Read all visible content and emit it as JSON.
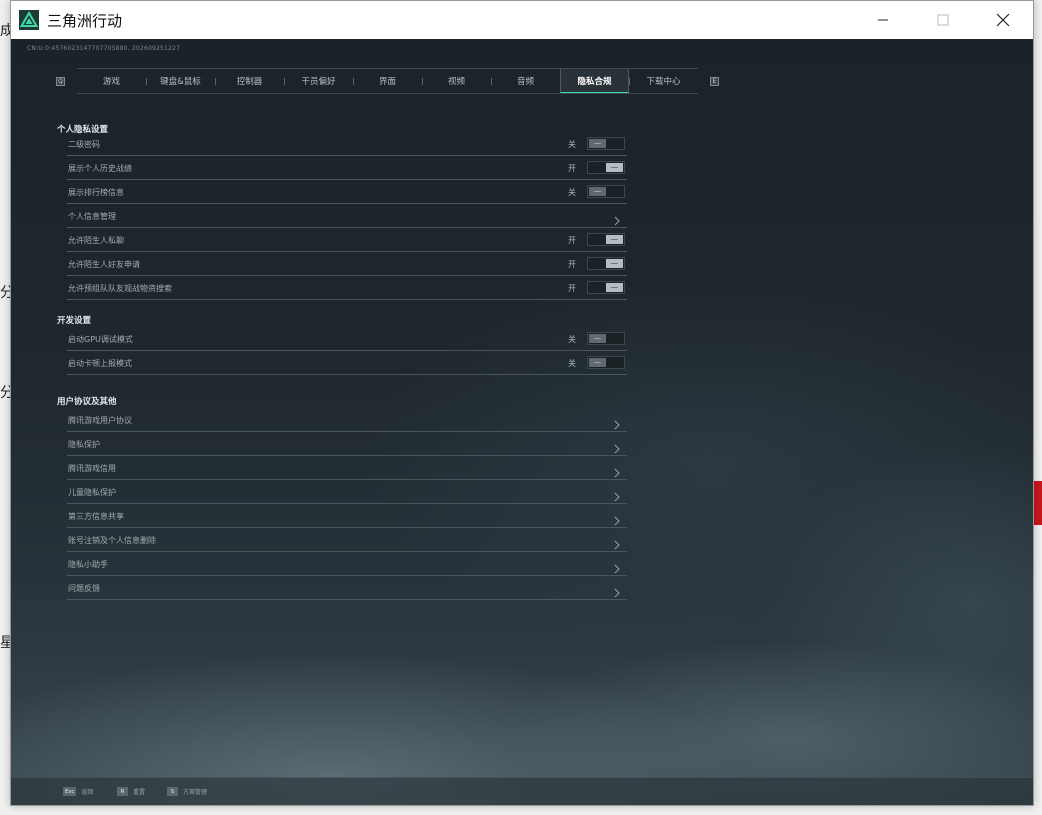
{
  "window": {
    "title": "三角洲行动"
  },
  "game": {
    "uid": "CN:U:0:4576023147707705880, 202609251227",
    "tabs": [
      {
        "label": "游戏",
        "active": false
      },
      {
        "label": "键盘&鼠标",
        "active": false
      },
      {
        "label": "控制器",
        "active": false
      },
      {
        "label": "干员偏好",
        "active": false
      },
      {
        "label": "界面",
        "active": false
      },
      {
        "label": "视频",
        "active": false
      },
      {
        "label": "音频",
        "active": false
      },
      {
        "label": "隐私合规",
        "active": true
      },
      {
        "label": "下载中心",
        "active": false
      }
    ],
    "tab_prev_key": "Q",
    "tab_next_key": "E"
  },
  "privacy": {
    "title": "个人隐私设置",
    "rows": [
      {
        "label": "二级密码",
        "state": "关",
        "on": false
      },
      {
        "label": "展示个人历史战绩",
        "state": "开",
        "on": true
      },
      {
        "label": "展示排行榜信息",
        "state": "关",
        "on": false
      },
      {
        "label": "个人信息管理"
      },
      {
        "label": "允许陌生人私聊",
        "state": "开",
        "on": true
      },
      {
        "label": "允许陌生人好友申请",
        "state": "开",
        "on": true
      },
      {
        "label": "允许预组队队友观战物资搜索",
        "state": "开",
        "on": true
      }
    ]
  },
  "dev": {
    "title": "开发设置",
    "rows": [
      {
        "label": "启动GPU调试模式",
        "state": "关",
        "on": false
      },
      {
        "label": "启动卡顿上报模式",
        "state": "关",
        "on": false
      }
    ]
  },
  "agreements": {
    "title": "用户协议及其他",
    "rows": [
      {
        "label": "腾讯游戏用户协议"
      },
      {
        "label": "隐私保护"
      },
      {
        "label": "腾讯游戏信用"
      },
      {
        "label": "儿童隐私保护"
      },
      {
        "label": "第三方信息共享"
      },
      {
        "label": "账号注销及个人信息删除"
      },
      {
        "label": "隐私小助手"
      },
      {
        "label": "问题反馈"
      }
    ]
  },
  "bottom_hints": [
    {
      "key": "Esc",
      "text": "返回"
    },
    {
      "key": "R",
      "text": "重置"
    },
    {
      "key": "S",
      "text": "方案管理"
    }
  ],
  "colors": {
    "accent": "#3fd6a8",
    "logo_bg": "#1e3a34"
  }
}
